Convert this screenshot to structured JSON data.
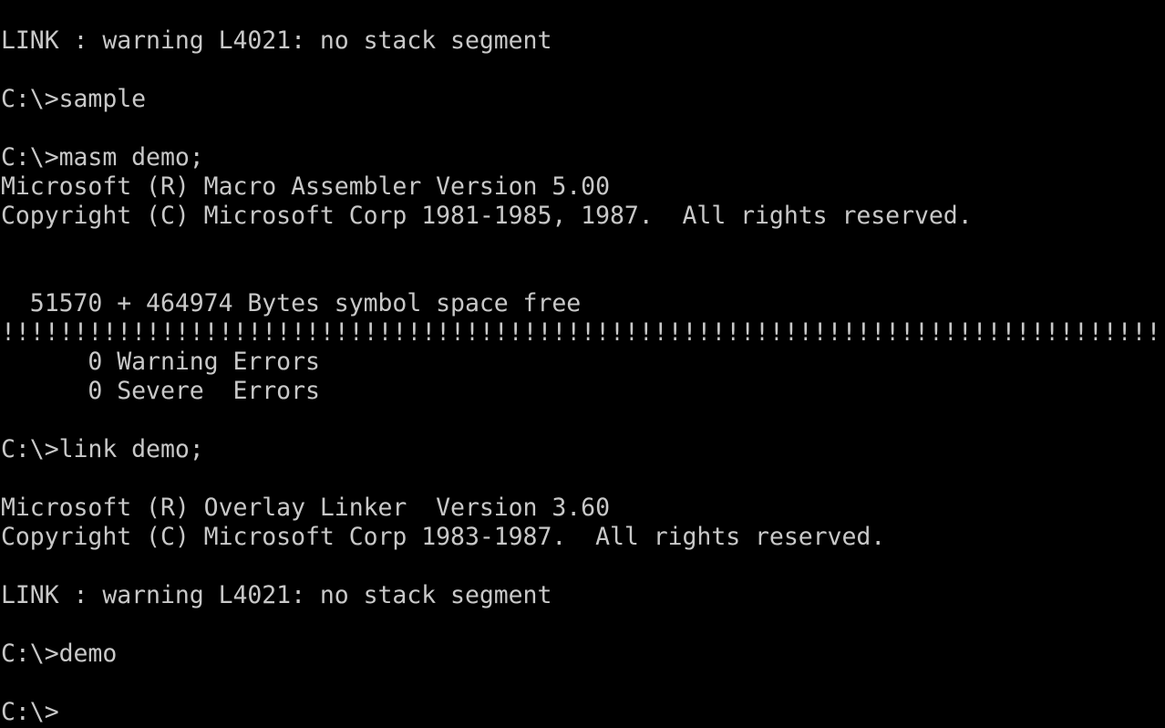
{
  "terminal": {
    "lines": [
      "LINK : warning L4021: no stack segment",
      "",
      "C:\\>sample",
      "",
      "C:\\>masm demo;",
      "Microsoft (R) Macro Assembler Version 5.00",
      "Copyright (C) Microsoft Corp 1981-1985, 1987.  All rights reserved.",
      "",
      "",
      "  51570 + 464974 Bytes symbol space free",
      "!!!!!!!!!!!!!!!!!!!!!!!!!!!!!!!!!!!!!!!!!!!!!!!!!!!!!!!!!!!!!!!!!!!!!!!!!!!!!!!!",
      "      0 Warning Errors",
      "      0 Severe  Errors",
      "",
      "C:\\>link demo;",
      "",
      "Microsoft (R) Overlay Linker  Version 3.60",
      "Copyright (C) Microsoft Corp 1983-1987.  All rights reserved.",
      "",
      "LINK : warning L4021: no stack segment",
      "",
      "C:\\>demo",
      "",
      "C:\\>"
    ],
    "colors": {
      "background": "#000000",
      "text": "#c8c8c8"
    }
  }
}
